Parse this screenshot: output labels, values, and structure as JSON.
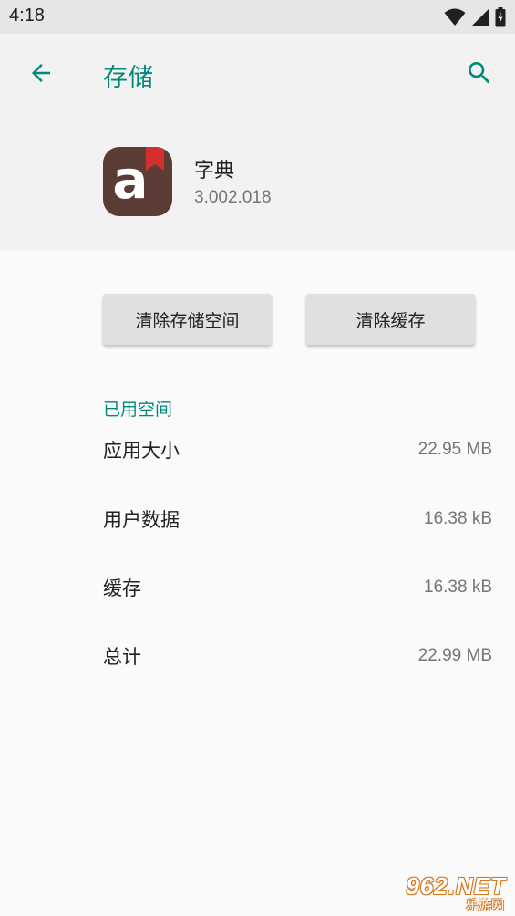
{
  "status_bar": {
    "time": "4:18",
    "icons": [
      "wifi-icon",
      "signal-icon",
      "battery-icon"
    ]
  },
  "header": {
    "title": "存储",
    "back_icon": "arrow-back-icon",
    "search_icon": "search-icon"
  },
  "app": {
    "name": "字典",
    "version": "3.002.018",
    "icon_letter": "a",
    "icon_color": "#5b3d35",
    "bookmark_color": "#d32f2f"
  },
  "buttons": {
    "clear_storage": "清除存储空间",
    "clear_cache": "清除缓存"
  },
  "storage": {
    "section_title": "已用空间",
    "rows": [
      {
        "label": "应用大小",
        "value": "22.95 MB"
      },
      {
        "label": "用户数据",
        "value": "16.38 kB"
      },
      {
        "label": "缓存",
        "value": "16.38 kB"
      },
      {
        "label": "总计",
        "value": "22.99 MB"
      }
    ]
  },
  "watermark": {
    "brand": "962.NET",
    "subtitle": "乐游网"
  },
  "colors": {
    "accent": "#00897b",
    "background": "#fafafa",
    "header_background": "#f2f2f2",
    "status_bar": "#e6e6e6"
  }
}
